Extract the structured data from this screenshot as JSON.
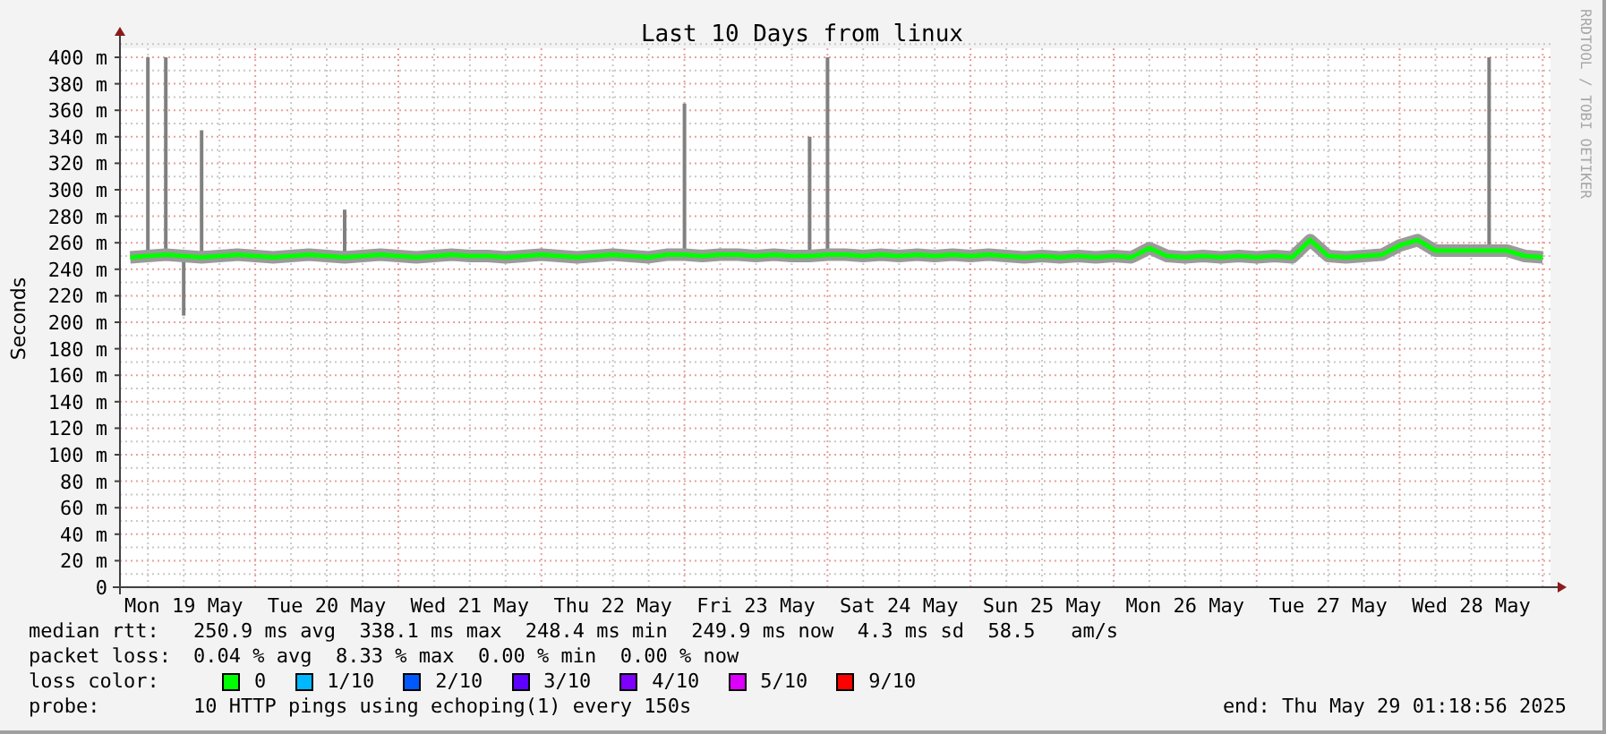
{
  "graph": {
    "chart_data": {
      "type": "line",
      "title": "Last 10 Days from linux",
      "ylabel": "Seconds",
      "categories": [
        null,
        null,
        null,
        "Mon 19 May",
        null,
        null,
        null,
        null,
        null,
        null,
        null,
        "Tue 20 May",
        null,
        null,
        null,
        null,
        null,
        null,
        null,
        "Wed 21 May",
        null,
        null,
        null,
        null,
        null,
        null,
        null,
        "Thu 22 May",
        null,
        null,
        null,
        null,
        null,
        null,
        null,
        "Fri 23 May",
        null,
        null,
        null,
        null,
        null,
        null,
        null,
        "Sat 24 May",
        null,
        null,
        null,
        null,
        null,
        null,
        null,
        "Sun 25 May",
        null,
        null,
        null,
        null,
        null,
        null,
        null,
        "Mon 26 May",
        null,
        null,
        null,
        null,
        null,
        null,
        null,
        "Tue 27 May",
        null,
        null,
        null,
        null,
        null,
        null,
        null,
        "Wed 28 May",
        null,
        null,
        null,
        null
      ],
      "ylim": [
        0,
        400
      ],
      "grid": true,
      "yticks": [
        {
          "value": 0,
          "label": "0"
        },
        {
          "value": 20,
          "label": "20 m"
        },
        {
          "value": 40,
          "label": "40 m"
        },
        {
          "value": 60,
          "label": "60 m"
        },
        {
          "value": 80,
          "label": "80 m"
        },
        {
          "value": 100,
          "label": "100 m"
        },
        {
          "value": 120,
          "label": "120 m"
        },
        {
          "value": 140,
          "label": "140 m"
        },
        {
          "value": 160,
          "label": "160 m"
        },
        {
          "value": 180,
          "label": "180 m"
        },
        {
          "value": 200,
          "label": "200 m"
        },
        {
          "value": 220,
          "label": "220 m"
        },
        {
          "value": 240,
          "label": "240 m"
        },
        {
          "value": 260,
          "label": "260 m"
        },
        {
          "value": 280,
          "label": "280 m"
        },
        {
          "value": 300,
          "label": "300 m"
        },
        {
          "value": 320,
          "label": "320 m"
        },
        {
          "value": 340,
          "label": "340 m"
        },
        {
          "value": 360,
          "label": "360 m"
        },
        {
          "value": 380,
          "label": "380 m"
        },
        {
          "value": 400,
          "label": "400 m"
        }
      ],
      "series": [
        {
          "color": "#00ff00",
          "values": [
            249,
            250,
            251,
            250,
            249,
            250,
            251,
            250,
            249,
            250,
            251,
            250,
            249,
            250,
            251,
            250,
            249,
            250,
            251,
            250,
            250,
            249,
            250,
            251,
            250,
            249,
            250,
            251,
            250,
            249,
            251,
            251,
            250,
            251,
            251,
            250,
            251,
            250,
            250,
            251,
            251,
            250,
            251,
            250,
            251,
            250,
            251,
            250,
            251,
            250,
            249,
            250,
            249,
            250,
            249,
            250,
            249,
            256,
            250,
            249,
            250,
            249,
            250,
            249,
            250,
            249,
            262,
            250,
            249,
            250,
            251,
            258,
            262,
            254,
            254,
            254,
            254,
            254,
            250,
            249
          ]
        }
      ]
    },
    "credit": "RRDTOOL / TOBI OETIKER"
  },
  "legend": {
    "median_rtt": {
      "label": "median rtt:",
      "text": "250.9 ms avg  338.1 ms max  248.4 ms min  249.9 ms now  4.3 ms sd  58.5   am/s"
    },
    "packet_loss": {
      "label": "packet loss:",
      "text": "0.04 % avg  8.33 % max  0.00 % min  0.00 % now"
    },
    "loss_color": {
      "label": "loss color:",
      "items": [
        {
          "label": "0",
          "color": "#00ff00"
        },
        {
          "label": "1/10",
          "color": "#00b8ff"
        },
        {
          "label": "2/10",
          "color": "#0059ff"
        },
        {
          "label": "3/10",
          "color": "#5e00ff"
        },
        {
          "label": "4/10",
          "color": "#7e00ff"
        },
        {
          "label": "5/10",
          "color": "#dd00ff"
        },
        {
          "label": "9/10",
          "color": "#ff0000"
        }
      ]
    },
    "probe": {
      "label": "probe:",
      "text": "10 HTTP pings using echoping(1) every 150s"
    },
    "end": "end: Thu May 29 01:18:56 2025"
  }
}
